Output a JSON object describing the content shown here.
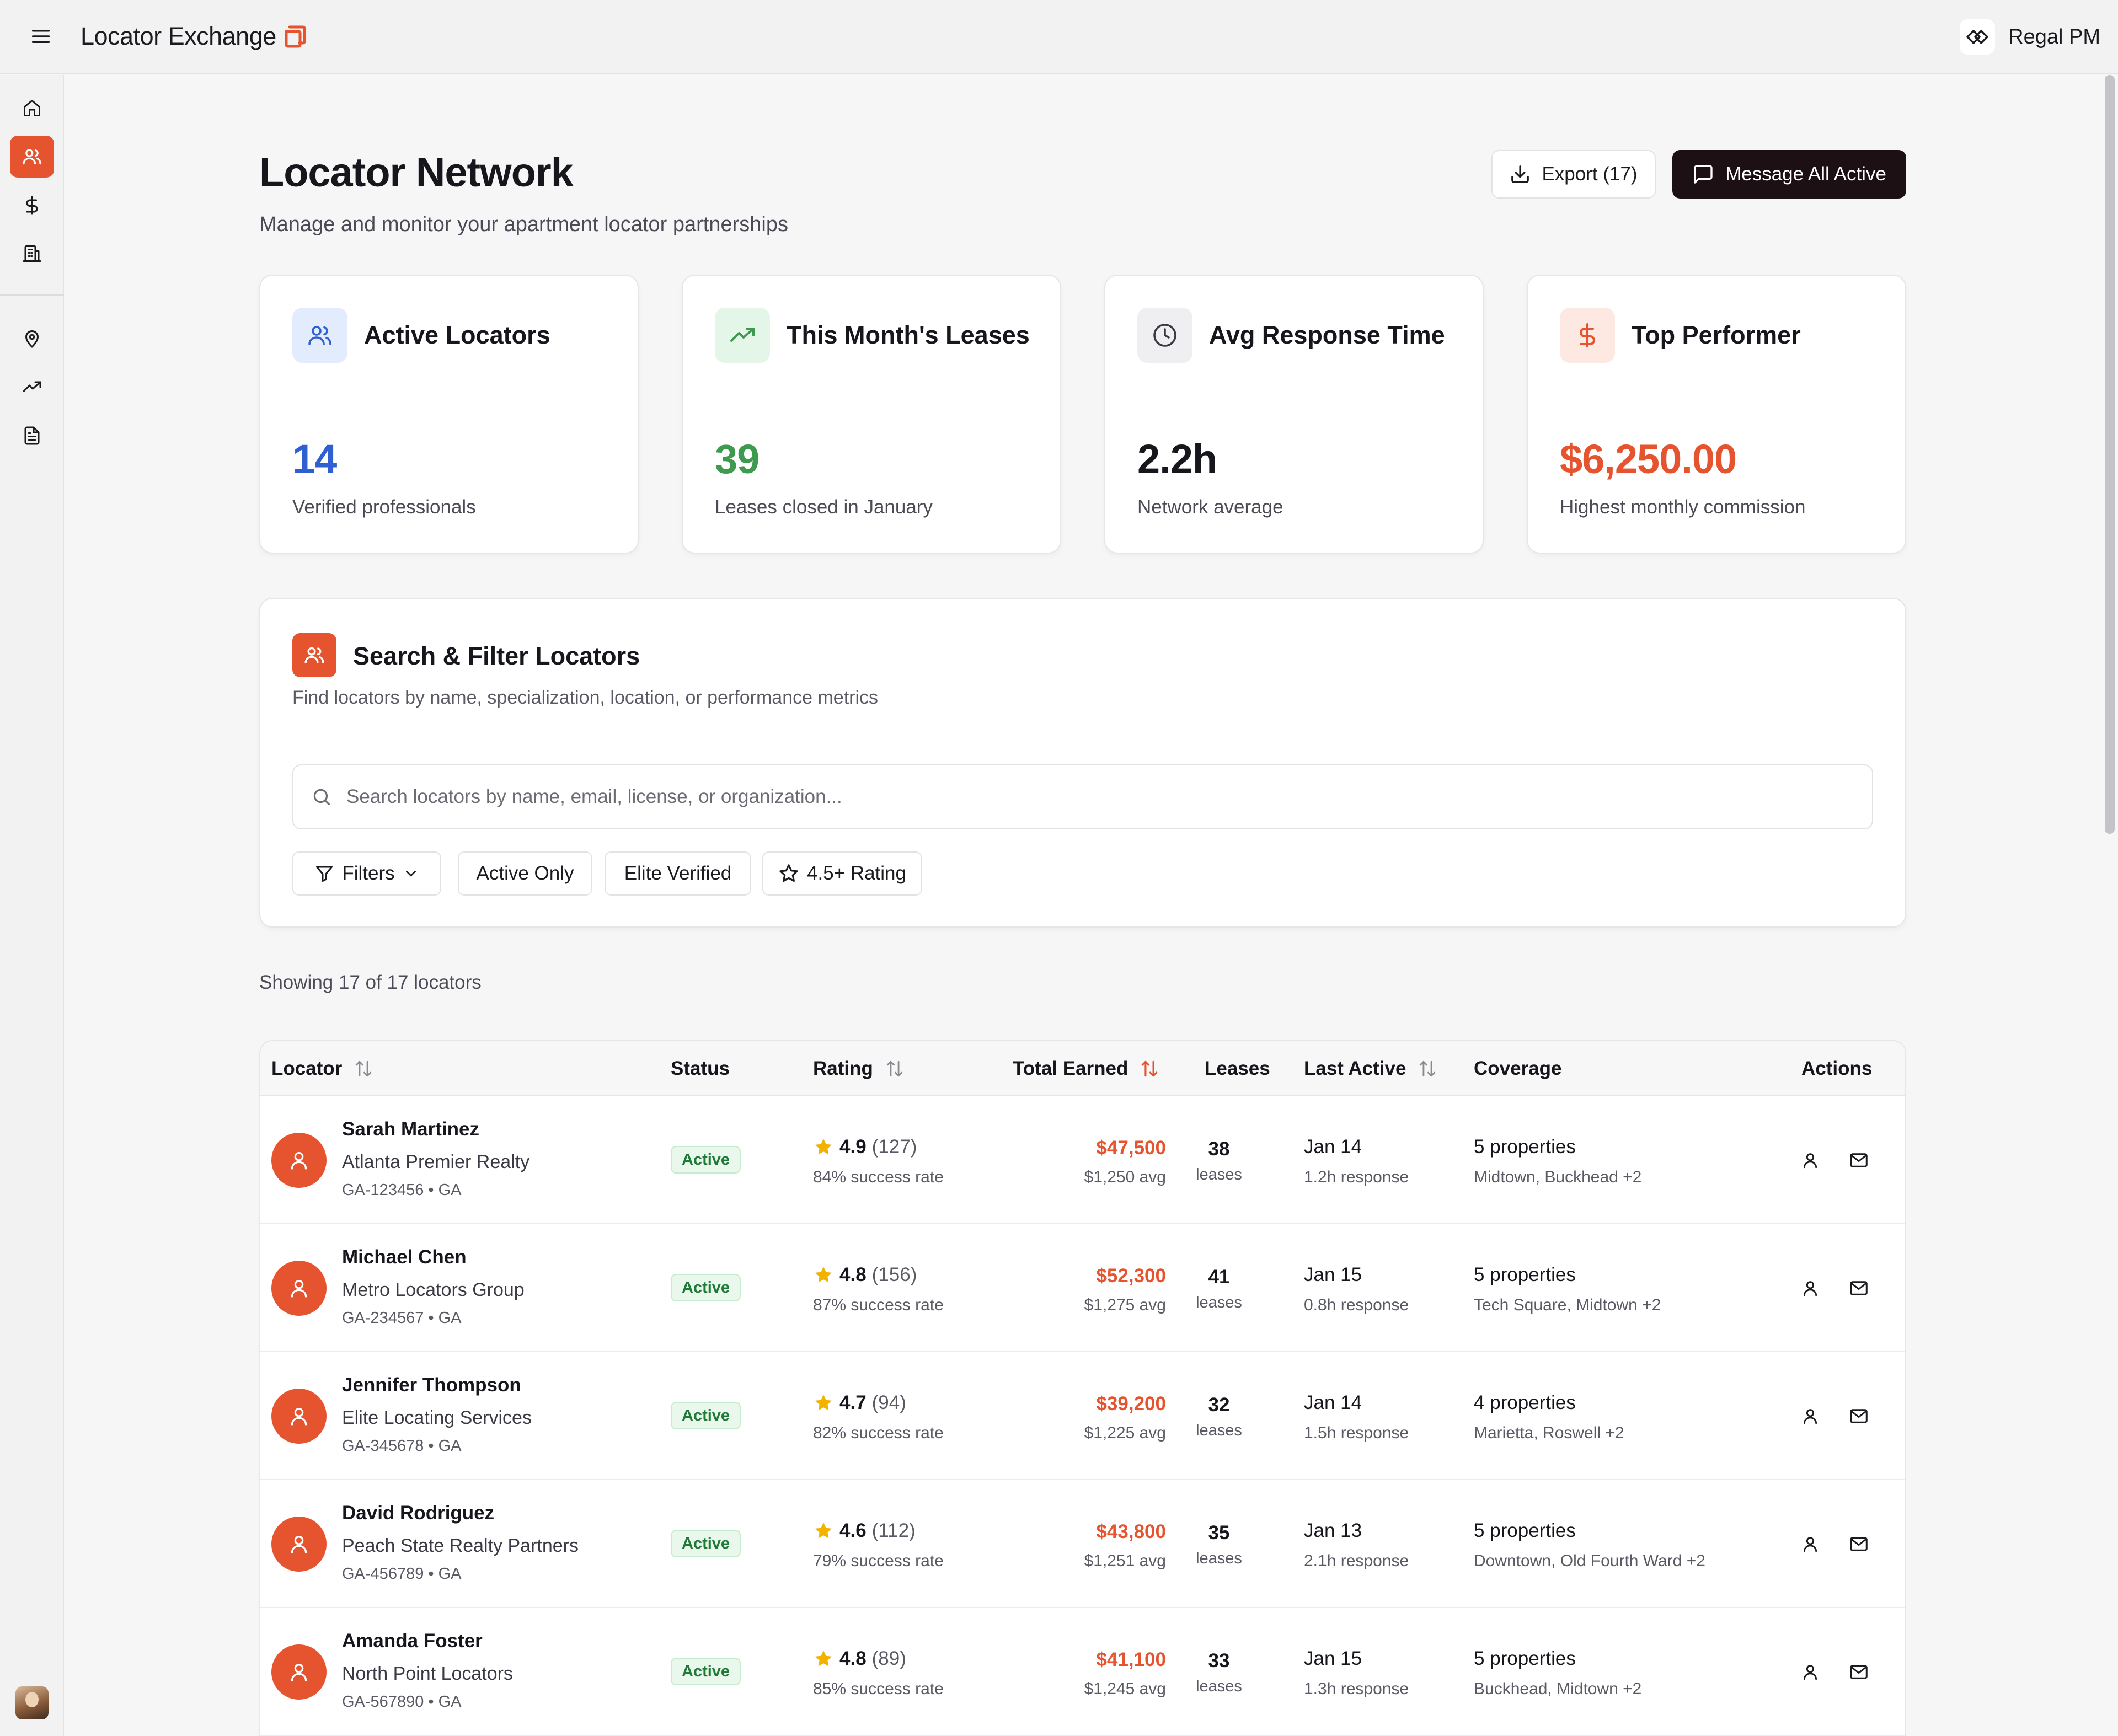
{
  "header": {
    "app_name": "Locator Exchange",
    "org_name": "Regal PM"
  },
  "sidebar": {
    "items": [
      {
        "icon": "home-icon",
        "active": false
      },
      {
        "icon": "users-icon",
        "active": true
      },
      {
        "icon": "dollar-icon",
        "active": false
      },
      {
        "icon": "building-icon",
        "active": false
      },
      {
        "icon": "map-pin-icon",
        "active": false
      },
      {
        "icon": "trending-up-icon",
        "active": false
      },
      {
        "icon": "document-icon",
        "active": false
      }
    ]
  },
  "page": {
    "title": "Locator Network",
    "subtitle": "Manage and monitor your apartment locator partnerships",
    "export_label": "Export (17)",
    "message_label": "Message All Active"
  },
  "stats": [
    {
      "title": "Active Locators",
      "value": "14",
      "caption": "Verified professionals",
      "color": "#2f5fd0",
      "icon": "users-icon"
    },
    {
      "title": "This Month's Leases",
      "value": "39",
      "caption": "Leases closed in January",
      "color": "#3e9a4f",
      "icon": "trending-up-icon"
    },
    {
      "title": "Avg Response Time",
      "value": "2.2h",
      "caption": "Network average",
      "color": "#16161c",
      "icon": "clock-icon"
    },
    {
      "title": "Top Performer",
      "value": "$6,250.00",
      "caption": "Highest monthly commission",
      "color": "#e5532f",
      "icon": "dollar-icon"
    }
  ],
  "search": {
    "title": "Search & Filter Locators",
    "description": "Find locators by name, specialization, location, or performance metrics",
    "placeholder": "Search locators by name, email, license, or organization...",
    "chips": {
      "filters": "Filters",
      "active_only": "Active Only",
      "elite_verified": "Elite Verified",
      "rating": "4.5+ Rating"
    }
  },
  "results": {
    "showing": "Showing 17 of 17 locators"
  },
  "table": {
    "columns": {
      "locator": "Locator",
      "status": "Status",
      "rating": "Rating",
      "total_earned": "Total Earned",
      "leases": "Leases",
      "last_active": "Last Active",
      "coverage": "Coverage",
      "actions": "Actions"
    },
    "rows": [
      {
        "name": "Sarah Martinez",
        "org": "Atlanta Premier Realty",
        "license": "GA-123456 • GA",
        "status": "Active",
        "rating": "4.9",
        "reviews": "(127)",
        "success": "84% success rate",
        "earned": "$47,500",
        "avg": "$1,250 avg",
        "leases": "38",
        "leases_label": "leases",
        "last_active": "Jan 14",
        "response": "1.2h response",
        "coverage": "5 properties",
        "areas": "Midtown, Buckhead +2"
      },
      {
        "name": "Michael Chen",
        "org": "Metro Locators Group",
        "license": "GA-234567 • GA",
        "status": "Active",
        "rating": "4.8",
        "reviews": "(156)",
        "success": "87% success rate",
        "earned": "$52,300",
        "avg": "$1,275 avg",
        "leases": "41",
        "leases_label": "leases",
        "last_active": "Jan 15",
        "response": "0.8h response",
        "coverage": "5 properties",
        "areas": "Tech Square, Midtown +2"
      },
      {
        "name": "Jennifer Thompson",
        "org": "Elite Locating Services",
        "license": "GA-345678 • GA",
        "status": "Active",
        "rating": "4.7",
        "reviews": "(94)",
        "success": "82% success rate",
        "earned": "$39,200",
        "avg": "$1,225 avg",
        "leases": "32",
        "leases_label": "leases",
        "last_active": "Jan 14",
        "response": "1.5h response",
        "coverage": "4 properties",
        "areas": "Marietta, Roswell +2"
      },
      {
        "name": "David Rodriguez",
        "org": "Peach State Realty Partners",
        "license": "GA-456789 • GA",
        "status": "Active",
        "rating": "4.6",
        "reviews": "(112)",
        "success": "79% success rate",
        "earned": "$43,800",
        "avg": "$1,251 avg",
        "leases": "35",
        "leases_label": "leases",
        "last_active": "Jan 13",
        "response": "2.1h response",
        "coverage": "5 properties",
        "areas": "Downtown, Old Fourth Ward +2"
      },
      {
        "name": "Amanda Foster",
        "org": "North Point Locators",
        "license": "GA-567890 • GA",
        "status": "Active",
        "rating": "4.8",
        "reviews": "(89)",
        "success": "85% success rate",
        "earned": "$41,100",
        "avg": "$1,245 avg",
        "leases": "33",
        "leases_label": "leases",
        "last_active": "Jan 15",
        "response": "1.3h response",
        "coverage": "5 properties",
        "areas": "Buckhead, Midtown +2"
      }
    ]
  },
  "colors": {
    "accent": "#e5532f",
    "dark_button": "#1d1014",
    "active_badge": "#1f7a36",
    "star": "#f0b400"
  }
}
